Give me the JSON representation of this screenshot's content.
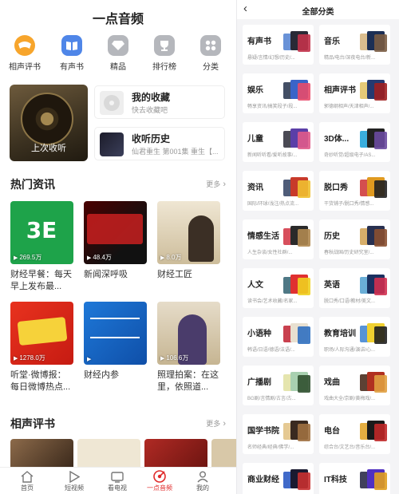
{
  "app_title": "一点音频",
  "categories": [
    {
      "label": "相声评书",
      "icon": "crosstalk-icon",
      "color": "#f7a52c"
    },
    {
      "label": "有声书",
      "icon": "book-icon",
      "color": "#4f86e8"
    },
    {
      "label": "精品",
      "icon": "diamond-icon",
      "color": "#b5b7bc"
    },
    {
      "label": "排行榜",
      "icon": "trophy-icon",
      "color": "#b5b7bc"
    },
    {
      "label": "分类",
      "icon": "grid-icon",
      "color": "#b5b7bc"
    }
  ],
  "last_listen": {
    "label": "上次收听"
  },
  "favorites": {
    "title": "我的收藏",
    "subtitle": "快去收藏吧"
  },
  "history": {
    "title": "收听历史",
    "subtitle": "仙君重生 第001集 重生【..."
  },
  "hot_news": {
    "title": "热门资讯",
    "more": "更多",
    "items": [
      {
        "title": "财经早餐：每天早上发布最...",
        "plays": "269.5万"
      },
      {
        "title": "新闻深呼吸",
        "plays": "48.4万"
      },
      {
        "title": "财经工匠",
        "plays": "8.0万"
      },
      {
        "title": "听堂·微博报：每日微博热点...",
        "plays": "1278.0万"
      },
      {
        "title": "财经内参",
        "plays": ""
      },
      {
        "title": "照理拍案：在这里，依照道...",
        "plays": "106.6万"
      }
    ]
  },
  "crosstalk": {
    "title": "相声评书",
    "more": "更多"
  },
  "tabbar": [
    {
      "label": "首页",
      "icon": "home-icon",
      "active": false
    },
    {
      "label": "短视频",
      "icon": "play-icon",
      "active": false
    },
    {
      "label": "看电视",
      "icon": "tv-icon",
      "active": false
    },
    {
      "label": "一点音频",
      "icon": "audio-icon",
      "active": true
    },
    {
      "label": "我的",
      "icon": "user-icon",
      "active": false
    }
  ],
  "genre_page": {
    "title": "全部分类",
    "back_icon": "back-arrow-icon",
    "genres": [
      {
        "name": "有声书",
        "sub": "悬疑/言情/幻想/历史/..."
      },
      {
        "name": "音乐",
        "sub": "精品/电台/深夜电台/新..."
      },
      {
        "name": "娱乐",
        "sub": "畅享资讯/搞笑段子/段..."
      },
      {
        "name": "相声评书",
        "sub": "郭德纲相声/天津相声/..."
      },
      {
        "name": "儿童",
        "sub": "新闻听听看/爱听故事/..."
      },
      {
        "name": "3D体...",
        "sub": "奇妙听觉/超级电子/AS..."
      },
      {
        "name": "资讯",
        "sub": "国际/环球/浅注/热点流..."
      },
      {
        "name": "脱口秀",
        "sub": "干货铺子/脱口秀/情感..."
      },
      {
        "name": "情感生活",
        "sub": "人生杂谈/女性社群/..."
      },
      {
        "name": "历史",
        "sub": "春秋战国/历史研究室/..."
      },
      {
        "name": "人文",
        "sub": "读书会/艺术收藏/名家..."
      },
      {
        "name": "英语",
        "sub": "脱口秀/口语/教材/美文..."
      },
      {
        "name": "小语种",
        "sub": "韩语/日语/德语/法语/..."
      },
      {
        "name": "教育培训",
        "sub": "职场/人际沟通/演讲/心..."
      },
      {
        "name": "广播剧",
        "sub": "BG剧/言情剧/古言/古..."
      },
      {
        "name": "戏曲",
        "sub": "戏曲大全/京剧/黄梅戏/..."
      },
      {
        "name": "国学书院",
        "sub": "名师经典/经典/佛学/..."
      },
      {
        "name": "电台",
        "sub": "综合台/文艺台/音乐台/..."
      },
      {
        "name": "商业财经",
        "sub": ""
      },
      {
        "name": "IT科技",
        "sub": ""
      }
    ]
  }
}
